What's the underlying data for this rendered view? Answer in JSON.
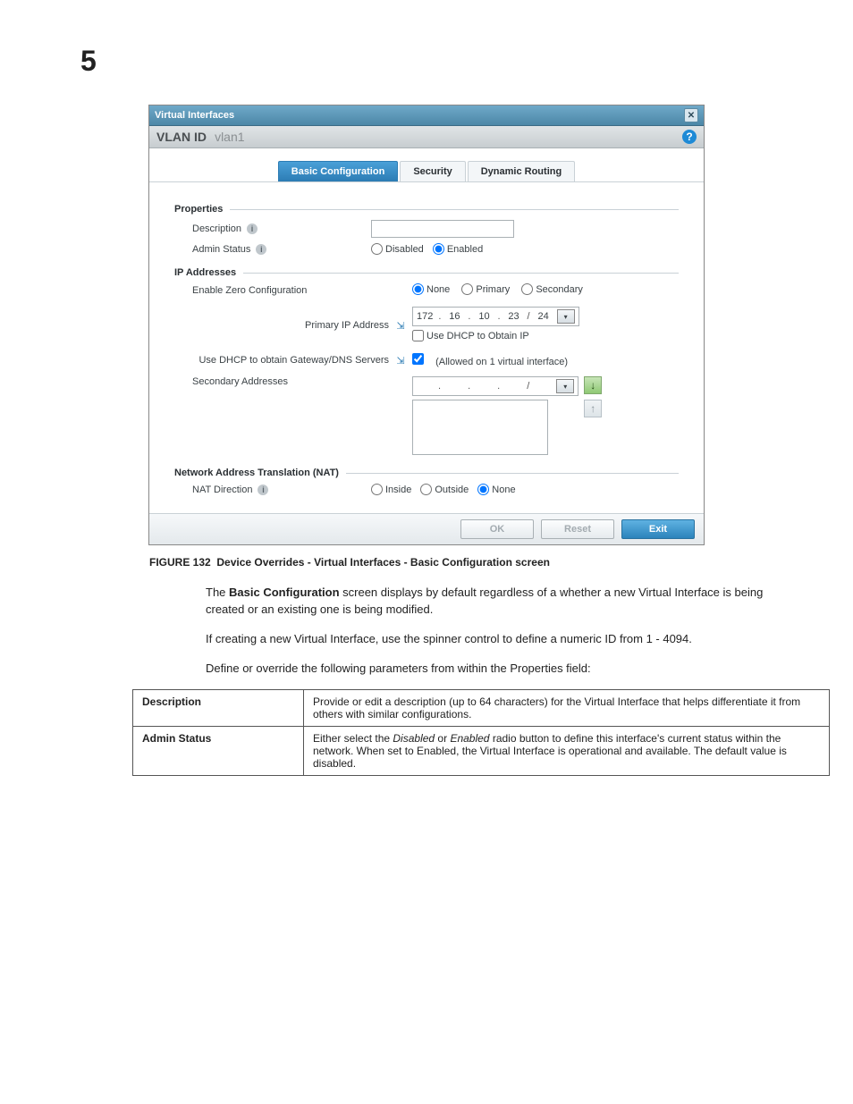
{
  "page_number": "5",
  "dialog": {
    "title": "Virtual Interfaces",
    "header_label": "VLAN ID",
    "header_value": "vlan1",
    "tabs": [
      {
        "label": "Basic Configuration",
        "active": true
      },
      {
        "label": "Security",
        "active": false
      },
      {
        "label": "Dynamic Routing",
        "active": false
      }
    ],
    "sections": {
      "properties": {
        "title": "Properties",
        "description_label": "Description",
        "description_value": "",
        "admin_status_label": "Admin Status",
        "admin_status_options": [
          "Disabled",
          "Enabled"
        ],
        "admin_status_selected": "Enabled"
      },
      "ip": {
        "title": "IP Addresses",
        "zero_conf_label": "Enable Zero Configuration",
        "zero_conf_options": [
          "None",
          "Primary",
          "Secondary"
        ],
        "zero_conf_selected": "None",
        "primary_ip_label": "Primary IP Address",
        "primary_ip": {
          "o1": "172",
          "o2": "16",
          "o3": "10",
          "o4": "23",
          "mask": "24"
        },
        "use_dhcp_ip_label": "Use DHCP to Obtain IP",
        "use_dhcp_ip_checked": false,
        "use_dhcp_gw_label": "Use DHCP to obtain Gateway/DNS Servers",
        "use_dhcp_gw_checked": true,
        "use_dhcp_gw_note": "(Allowed on 1 virtual interface)",
        "secondary_label": "Secondary Addresses"
      },
      "nat": {
        "title": "Network Address Translation (NAT)",
        "direction_label": "NAT Direction",
        "options": [
          "Inside",
          "Outside",
          "None"
        ],
        "selected": "None"
      }
    },
    "buttons": {
      "ok": "OK",
      "reset": "Reset",
      "exit": "Exit"
    }
  },
  "caption": {
    "figure_label": "FIGURE 132",
    "text": "Device Overrides - Virtual Interfaces - Basic Configuration screen"
  },
  "paragraphs": {
    "p1_a": "The ",
    "p1_b": "Basic Configuration",
    "p1_c": " screen displays by default regardless of a whether a new Virtual Interface is being created or an existing one is being modified.",
    "p2": "If creating a new Virtual Interface, use the spinner control to define a numeric ID from 1 - 4094.",
    "p3": "Define or override the following parameters from within the Properties field:"
  },
  "table": {
    "rows": [
      {
        "key": "Description",
        "value": "Provide or edit a description (up to 64 characters) for the Virtual Interface that helps differentiate it from others with similar configurations."
      },
      {
        "key": "Admin Status",
        "value_prefix": "Either select the ",
        "value_italic1": "Disabled",
        "value_mid": " or ",
        "value_italic2": "Enabled",
        "value_suffix": " radio button to define this interface's current status within the network. When set to Enabled, the Virtual Interface is operational and available. The default value is disabled."
      }
    ]
  }
}
